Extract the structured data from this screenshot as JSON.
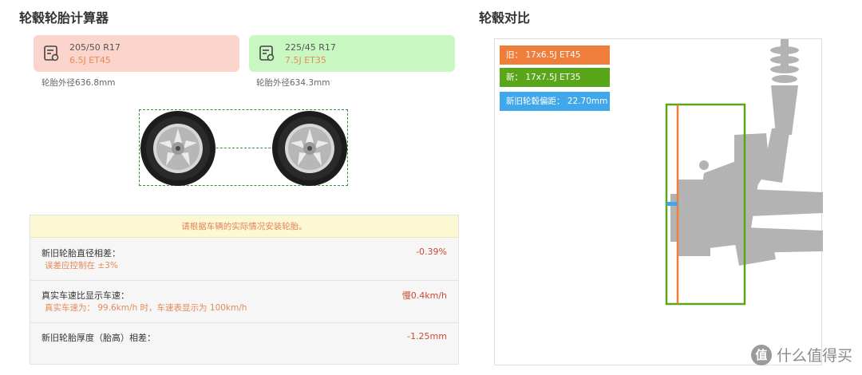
{
  "calculator": {
    "title": "轮毂轮胎计算器",
    "old_tire": {
      "size": "205/50 R17",
      "rim": "6.5J   ET45",
      "diameter": "轮胎外径636.8mm"
    },
    "new_tire": {
      "size": "225/45 R17",
      "rim": "7.5J   ET35",
      "diameter": "轮胎外径634.3mm"
    },
    "notice": "请根据车辆的实际情况安装轮胎。",
    "results": [
      {
        "label": "新旧轮胎直径相差：",
        "sub": "误差应控制在  ±3%",
        "value": "-0.39%"
      },
      {
        "label": "真实车速比显示车速：",
        "sub": "真实车速为： 99.6km/h 时，车速表显示为 100km/h",
        "value": "慢0.4km/h"
      },
      {
        "label": "新旧轮胎厚度（胎高）相差：",
        "sub": "",
        "value": "-1.25mm"
      }
    ]
  },
  "comparison": {
    "title": "轮毂对比",
    "legend_old": "旧： 17x6.5J ET45",
    "legend_new": "新： 17x7.5J ET35",
    "legend_offset": "新旧轮毂偏距： 22.70mm"
  },
  "colors": {
    "old": "#ef7e3b",
    "new": "#5aa61a",
    "offset": "#3fa7ea"
  },
  "watermark": {
    "badge": "值",
    "text": "什么值得买"
  }
}
